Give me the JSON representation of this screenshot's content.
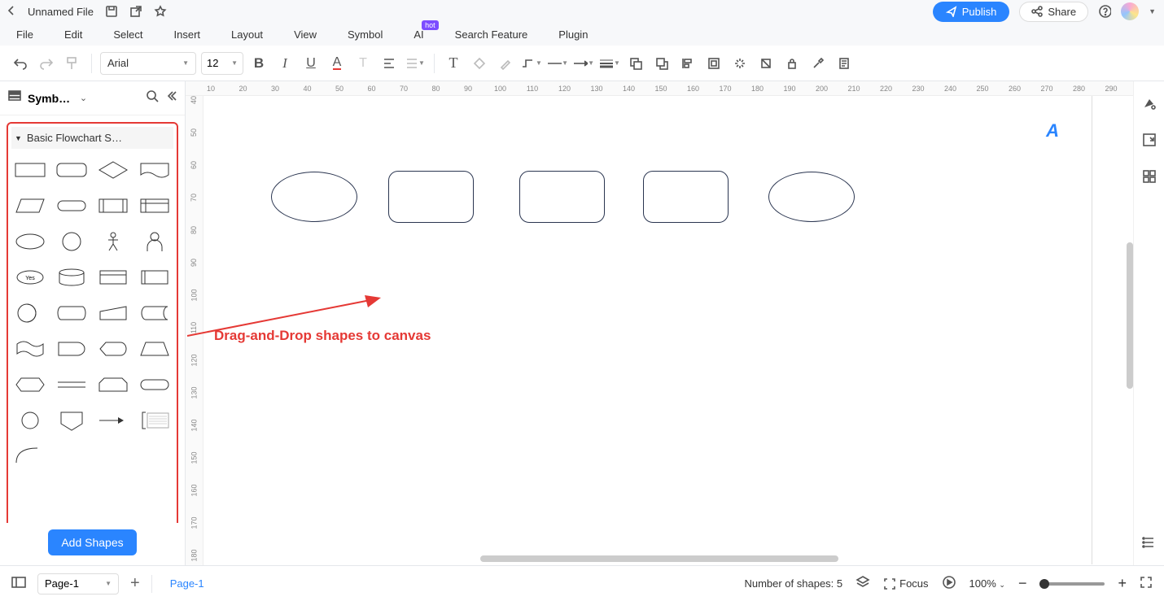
{
  "titlebar": {
    "filename": "Unnamed File",
    "publish": "Publish",
    "share": "Share"
  },
  "menu": {
    "file": "File",
    "edit": "Edit",
    "select": "Select",
    "insert": "Insert",
    "layout": "Layout",
    "view": "View",
    "symbol": "Symbol",
    "ai": "AI",
    "hot": "hot",
    "search": "Search Feature",
    "plugin": "Plugin"
  },
  "toolbar": {
    "font": "Arial",
    "size": "12"
  },
  "sidebar": {
    "title": "Symbol…",
    "category": "Basic Flowchart S…",
    "yes": "Yes",
    "add": "Add Shapes"
  },
  "hruler": [
    "10",
    "20",
    "30",
    "40",
    "50",
    "60",
    "70",
    "80",
    "90",
    "100",
    "110",
    "120",
    "130",
    "140",
    "150",
    "160",
    "170",
    "180",
    "190",
    "200",
    "210",
    "220",
    "230",
    "240",
    "250",
    "260",
    "270",
    "280",
    "290"
  ],
  "vruler": [
    "40",
    "50",
    "60",
    "70",
    "80",
    "90",
    "100",
    "110",
    "120",
    "130",
    "140",
    "150",
    "160",
    "170",
    "180"
  ],
  "annotation": "Drag-and-Drop shapes to canvas",
  "bottom": {
    "page": "Page-1",
    "tab": "Page-1",
    "shapes": "Number of shapes: 5",
    "focus": "Focus",
    "zoom": "100%"
  }
}
